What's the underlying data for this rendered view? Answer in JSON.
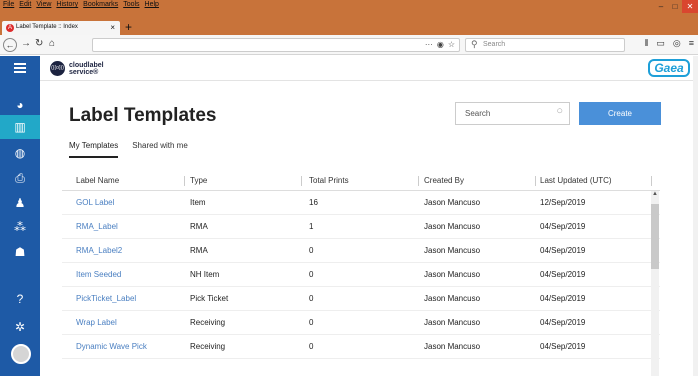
{
  "browser": {
    "menu": [
      "File",
      "Edit",
      "View",
      "History",
      "Bookmarks",
      "Tools",
      "Help"
    ],
    "tab_title": "Label Template :: Index",
    "tab_close": "×",
    "newtab": "+",
    "search_placeholder": "Search"
  },
  "app": {
    "brand_line1": "cloudlabel",
    "brand_line2": "service®",
    "brand_badge": "(((o)))",
    "gaea": "Gaea"
  },
  "page": {
    "title": "Label Templates",
    "search_placeholder": "Search",
    "create_label": "Create",
    "tabs": [
      {
        "label": "My Templates",
        "active": true
      },
      {
        "label": "Shared with me",
        "active": false
      }
    ]
  },
  "table": {
    "columns": [
      "Label Name",
      "Type",
      "Total Prints",
      "Created By",
      "Last Updated (UTC)"
    ],
    "rows": [
      [
        "GOL Label",
        "Item",
        "16",
        "Jason Mancuso",
        "12/Sep/2019"
      ],
      [
        "RMA_Label",
        "RMA",
        "1",
        "Jason Mancuso",
        "04/Sep/2019"
      ],
      [
        "RMA_Label2",
        "RMA",
        "0",
        "Jason Mancuso",
        "04/Sep/2019"
      ],
      [
        "Item Seeded",
        "NH Item",
        "0",
        "Jason Mancuso",
        "04/Sep/2019"
      ],
      [
        "PickTicket_Label",
        "Pick Ticket",
        "0",
        "Jason Mancuso",
        "04/Sep/2019"
      ],
      [
        "Wrap Label",
        "Receiving",
        "0",
        "Jason Mancuso",
        "04/Sep/2019"
      ],
      [
        "Dynamic Wave Pick",
        "Receiving",
        "0",
        "Jason Mancuso",
        "04/Sep/2019"
      ]
    ]
  },
  "colors": {
    "sidebar": "#1e5aa6",
    "sidebar_active": "#22a8c8",
    "accent": "#4a90d9",
    "link": "#4a7fc1",
    "titlebar": "#c8733a"
  }
}
